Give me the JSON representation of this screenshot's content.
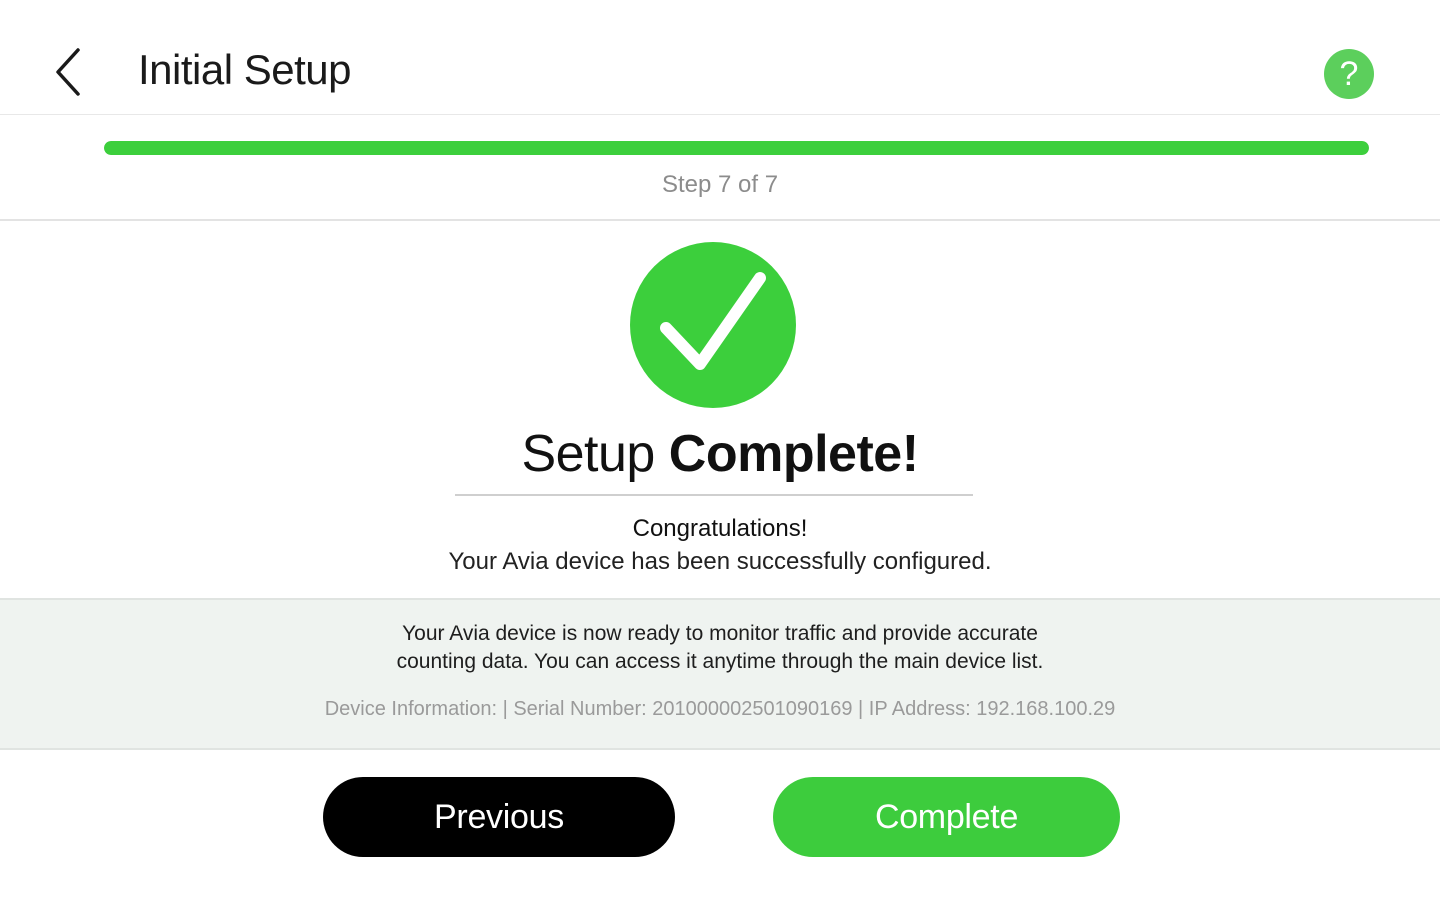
{
  "header": {
    "title": "Initial Setup",
    "back_icon": "chevron-left-icon",
    "help_label": "?",
    "help_icon": "help-icon"
  },
  "progress": {
    "step_label": "Step 7 of 7",
    "fraction": 1.0,
    "color": "#3ccf3c"
  },
  "main": {
    "success_icon": "checkmark-circle-icon",
    "success_color": "#3ccf3c",
    "title_light": "Setup",
    "title_bold": "Complete!",
    "congrats": "Congratulations!",
    "message": "Your Avia device has been successfully configured."
  },
  "info": {
    "line1": "Your Avia device is now ready to monitor traffic and provide accurate",
    "line2": "counting data. You can access it anytime through the main device list.",
    "device_info": "Device Information: | Serial Number: 20100000250109016​9 | IP Address: 192.168.100.29"
  },
  "actions": {
    "previous_label": "Previous",
    "complete_label": "Complete",
    "complete_color": "#3dcc3d"
  }
}
